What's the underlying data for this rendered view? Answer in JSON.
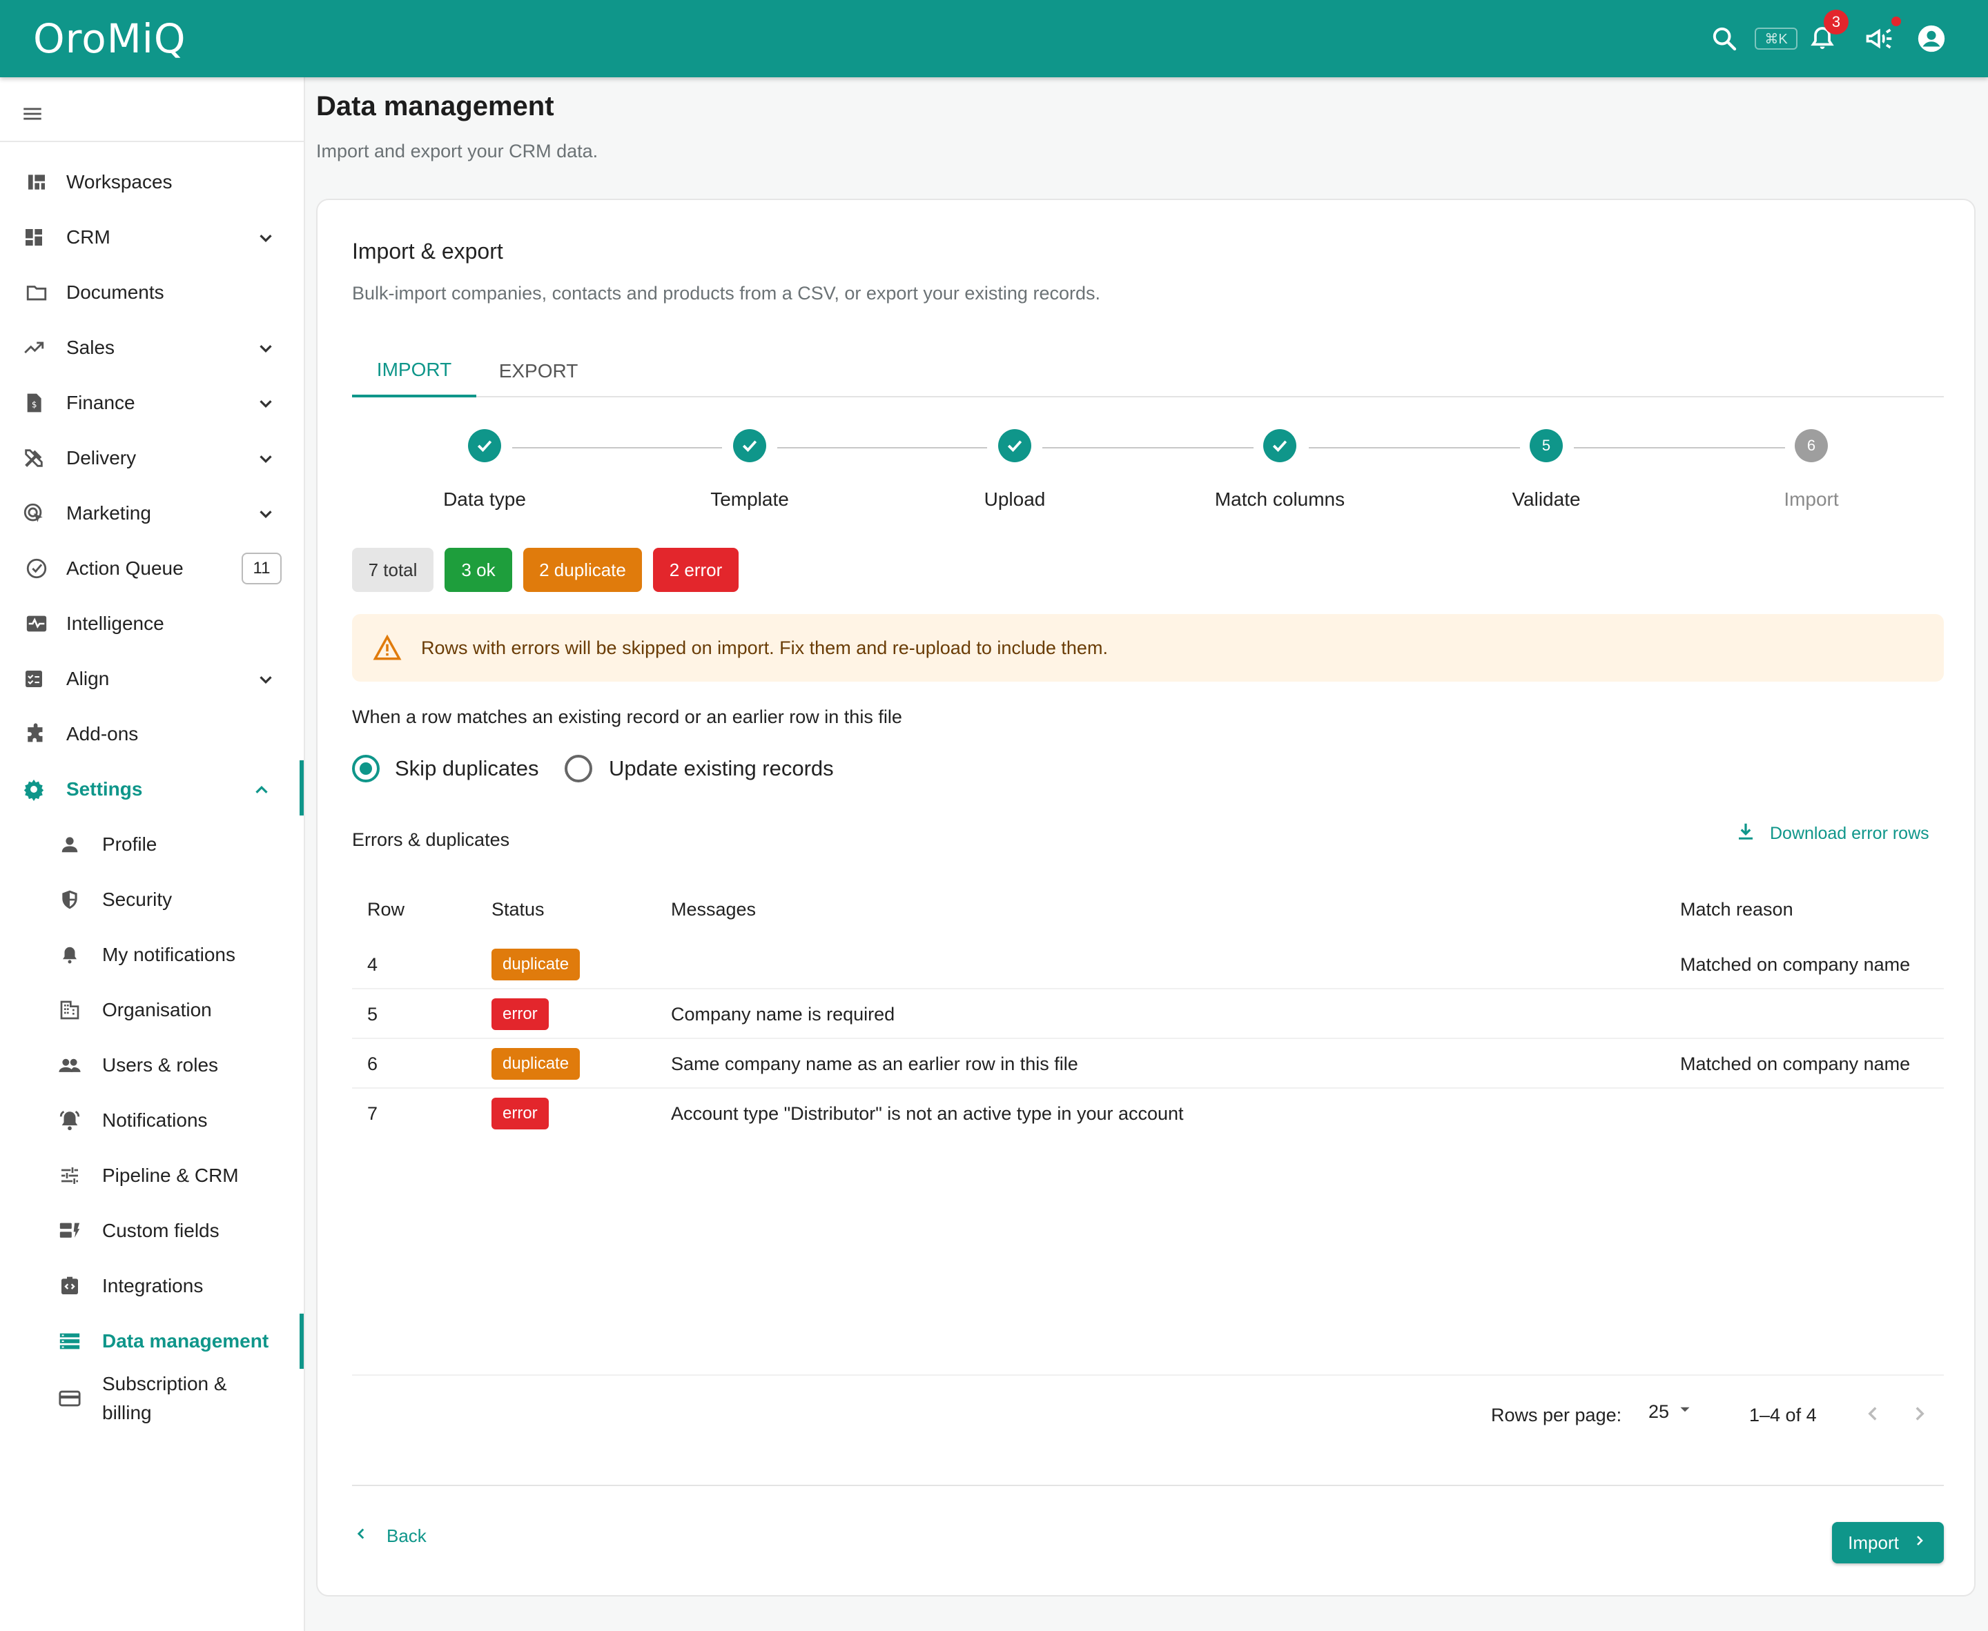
{
  "app": {
    "logo": "OroMiQ",
    "kbd_hint": "⌘K",
    "notif_count": "3"
  },
  "sidebar": {
    "items": [
      {
        "label": "Workspaces"
      },
      {
        "label": "CRM"
      },
      {
        "label": "Documents"
      },
      {
        "label": "Sales"
      },
      {
        "label": "Finance"
      },
      {
        "label": "Delivery"
      },
      {
        "label": "Marketing"
      },
      {
        "label": "Action Queue",
        "count": "11"
      },
      {
        "label": "Intelligence"
      },
      {
        "label": "Align"
      },
      {
        "label": "Add-ons"
      },
      {
        "label": "Settings"
      }
    ],
    "settings_items": [
      {
        "label": "Profile"
      },
      {
        "label": "Security"
      },
      {
        "label": "My notifications"
      },
      {
        "label": "Organisation"
      },
      {
        "label": "Users & roles"
      },
      {
        "label": "Notifications"
      },
      {
        "label": "Pipeline & CRM"
      },
      {
        "label": "Custom fields"
      },
      {
        "label": "Integrations"
      },
      {
        "label": "Data management"
      },
      {
        "label": "Subscription &"
      },
      {
        "label": "billing"
      }
    ]
  },
  "page": {
    "title": "Data management",
    "subtitle": "Import and export your CRM data."
  },
  "card": {
    "title": "Import & export",
    "subtitle": "Bulk-import companies, contacts and products from a CSV, or export your existing records.",
    "tabs": [
      {
        "label": "IMPORT"
      },
      {
        "label": "EXPORT"
      }
    ],
    "steps": [
      {
        "label": "Data type",
        "state": "done"
      },
      {
        "label": "Template",
        "state": "done"
      },
      {
        "label": "Upload",
        "state": "done"
      },
      {
        "label": "Match columns",
        "state": "done"
      },
      {
        "label": "Validate",
        "state": "active",
        "num": "5"
      },
      {
        "label": "Import",
        "state": "pending",
        "num": "6"
      }
    ],
    "summary": [
      {
        "label": "7 total"
      },
      {
        "label": "3 ok"
      },
      {
        "label": "2 duplicate"
      },
      {
        "label": "2 error"
      }
    ],
    "alert": "Rows with errors will be skipped on import. Fix them and re-upload to include them.",
    "dup_question": "When a row matches an existing record or an earlier row in this file",
    "dup_options": [
      {
        "label": "Skip duplicates",
        "selected": true
      },
      {
        "label": "Update existing records",
        "selected": false
      }
    ],
    "errors_title": "Errors & duplicates",
    "download_label": "Download error rows",
    "table": {
      "headers": [
        "Row",
        "Status",
        "Messages",
        "Match reason"
      ],
      "rows": [
        {
          "row": "4",
          "status": "duplicate",
          "message": "",
          "reason": "Matched on company name"
        },
        {
          "row": "5",
          "status": "error",
          "message": "Company name is required",
          "reason": ""
        },
        {
          "row": "6",
          "status": "duplicate",
          "message": "Same company name as an earlier row in this file",
          "reason": "Matched on company name"
        },
        {
          "row": "7",
          "status": "error",
          "message": "Account type \"Distributor\" is not an active type in your account",
          "reason": ""
        }
      ]
    },
    "pagination": {
      "rows_per_page_label": "Rows per page:",
      "rows_per_page": "25",
      "range": "1–4 of 4"
    },
    "back_label": "Back",
    "import_label": "Import"
  },
  "colors": {
    "accent": "#0f968a",
    "ok": "#1e9e3c",
    "duplicate": "#e07b0c",
    "error": "#e3262c",
    "total": "#e6e6e6",
    "pending": "#9e9e9e"
  }
}
